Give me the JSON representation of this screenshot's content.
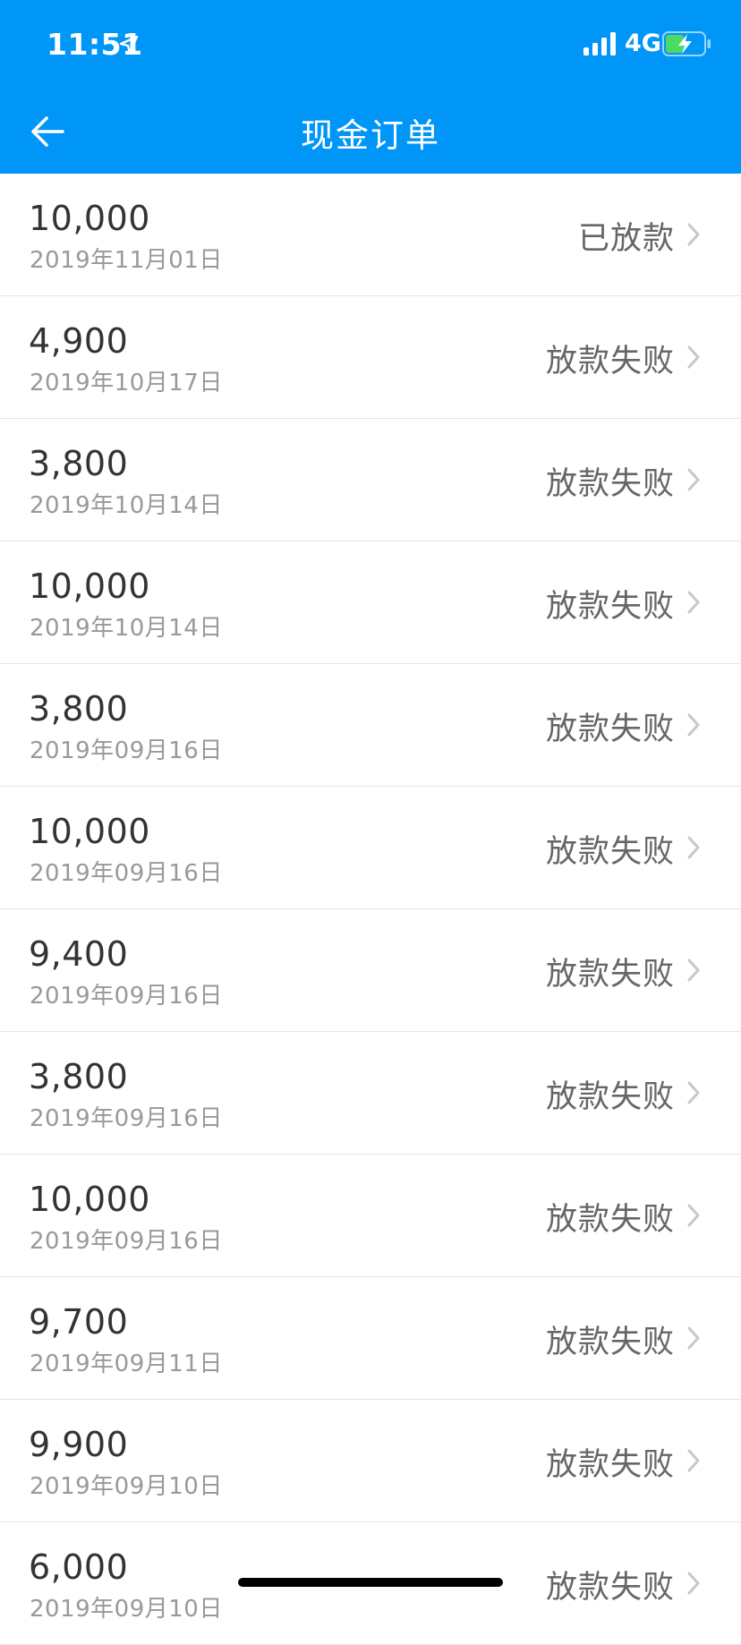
{
  "status_bar": {
    "time": "11:51",
    "network": "4G",
    "icons": [
      "location-arrow-icon",
      "signal-icon",
      "battery-charging-icon"
    ]
  },
  "nav": {
    "title": "现金订单",
    "back_icon": "back-arrow-icon"
  },
  "colors": {
    "header": "#0096f8",
    "amount": "#333333",
    "date": "#999999",
    "status": "#666666",
    "battery": "#4cd964"
  },
  "orders": [
    {
      "amount": "10,000",
      "date": "2019年11月01日",
      "status": "已放款"
    },
    {
      "amount": "4,900",
      "date": "2019年10月17日",
      "status": "放款失败"
    },
    {
      "amount": "3,800",
      "date": "2019年10月14日",
      "status": "放款失败"
    },
    {
      "amount": "10,000",
      "date": "2019年10月14日",
      "status": "放款失败"
    },
    {
      "amount": "3,800",
      "date": "2019年09月16日",
      "status": "放款失败"
    },
    {
      "amount": "10,000",
      "date": "2019年09月16日",
      "status": "放款失败"
    },
    {
      "amount": "9,400",
      "date": "2019年09月16日",
      "status": "放款失败"
    },
    {
      "amount": "3,800",
      "date": "2019年09月16日",
      "status": "放款失败"
    },
    {
      "amount": "10,000",
      "date": "2019年09月16日",
      "status": "放款失败"
    },
    {
      "amount": "9,700",
      "date": "2019年09月11日",
      "status": "放款失败"
    },
    {
      "amount": "9,900",
      "date": "2019年09月10日",
      "status": "放款失败"
    },
    {
      "amount": "6,000",
      "date": "2019年09月10日",
      "status": "放款失败"
    }
  ]
}
